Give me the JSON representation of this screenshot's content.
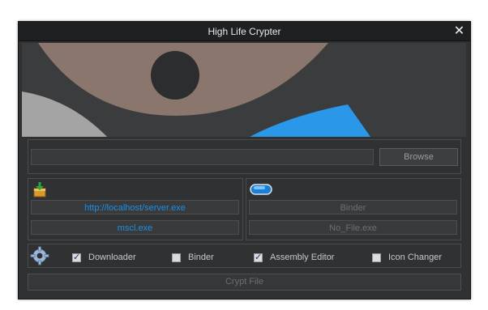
{
  "window": {
    "title": "High Life Crypter",
    "close_glyph": "✕"
  },
  "file": {
    "path_value": "",
    "browse_label": "Browse"
  },
  "downloader": {
    "icon": "download-package-icon",
    "url": "http://localhost/server.exe",
    "filename": "mscl.exe"
  },
  "binder": {
    "icon": "binder-pill-icon",
    "label": "Binder",
    "file": "No_File.exe"
  },
  "options": {
    "icon": "gear-icon",
    "items": [
      {
        "label": "Downloader",
        "checked": true
      },
      {
        "label": "Binder",
        "checked": false
      },
      {
        "label": "Assembly Editor",
        "checked": true
      },
      {
        "label": "Icon Changer",
        "checked": false
      }
    ]
  },
  "crypt": {
    "label": "Crypt File"
  },
  "colors": {
    "accent": "#1e8fe6",
    "banner_brown": "#8a766c",
    "banner_blue": "#2a97e8"
  }
}
